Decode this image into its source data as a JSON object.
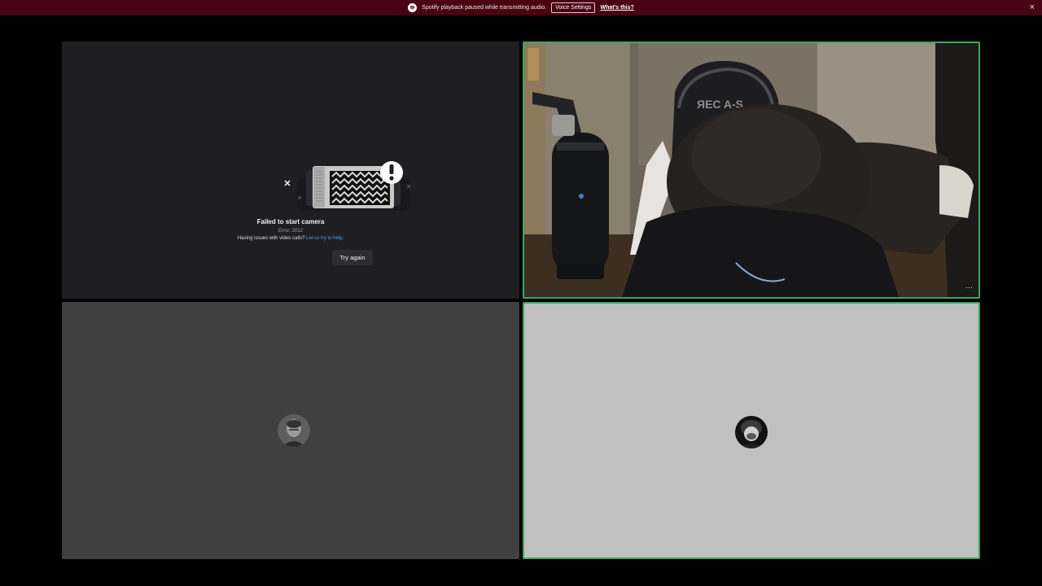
{
  "notice": {
    "text": "Spotify playback paused while transmitting audio.",
    "button_label": "Voice Settings",
    "link_text": "What's this?",
    "close_glyph": "×",
    "icon": "spotify-icon",
    "background": "#4a0313"
  },
  "tiles": [
    {
      "kind": "camera-error",
      "title": "Failed to start camera",
      "error_code": "Error: 2012",
      "help_text": "Having issues with video calls?",
      "help_link": "Let us try to help.",
      "retry_label": "Try again",
      "illustration": "broken-camera-icon"
    },
    {
      "kind": "video",
      "speaking": true,
      "menu_glyph": "···",
      "border_color": "#3fa45f"
    },
    {
      "kind": "avatar",
      "avatar": "user-avatar-icon",
      "background": "#404040"
    },
    {
      "kind": "avatar",
      "avatar": "user-avatar-icon",
      "speaking": true,
      "background": "#c0c0c0",
      "border_color": "#3fa45f"
    }
  ]
}
